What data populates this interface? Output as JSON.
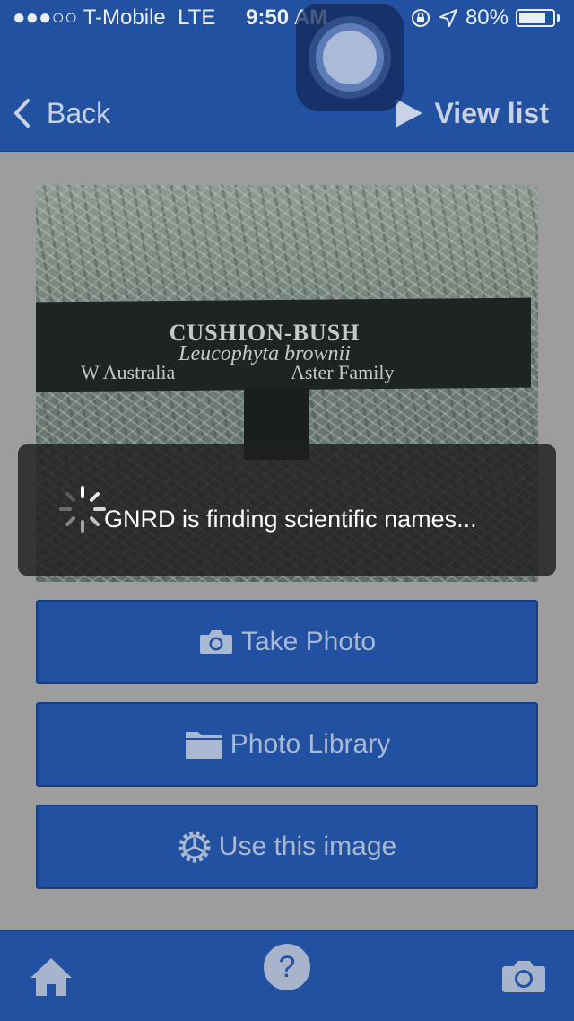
{
  "status_bar": {
    "carrier": "●●●○○ T-Mobile",
    "network": "LTE",
    "time": "9:50 AM",
    "battery": "80%",
    "battery_level": 0.8
  },
  "nav": {
    "back_label": "Back",
    "view_list_label": "View list"
  },
  "photo": {
    "sign_title": "CUSHION-BUSH",
    "sign_latin": "Leucophyta brownii",
    "sign_region": "W Australia",
    "sign_family": "Aster Family"
  },
  "buttons": {
    "take_photo": "Take Photo",
    "photo_library": "Photo Library",
    "use_image": "Use this image"
  },
  "hud": {
    "message": "GNRD is finding scientific names..."
  },
  "tab_bar": {
    "help_symbol": "?"
  },
  "colors": {
    "nav_blue": "#2151a0",
    "dim_overlay": "#9d9d9d",
    "button_text": "#aab8d2"
  }
}
